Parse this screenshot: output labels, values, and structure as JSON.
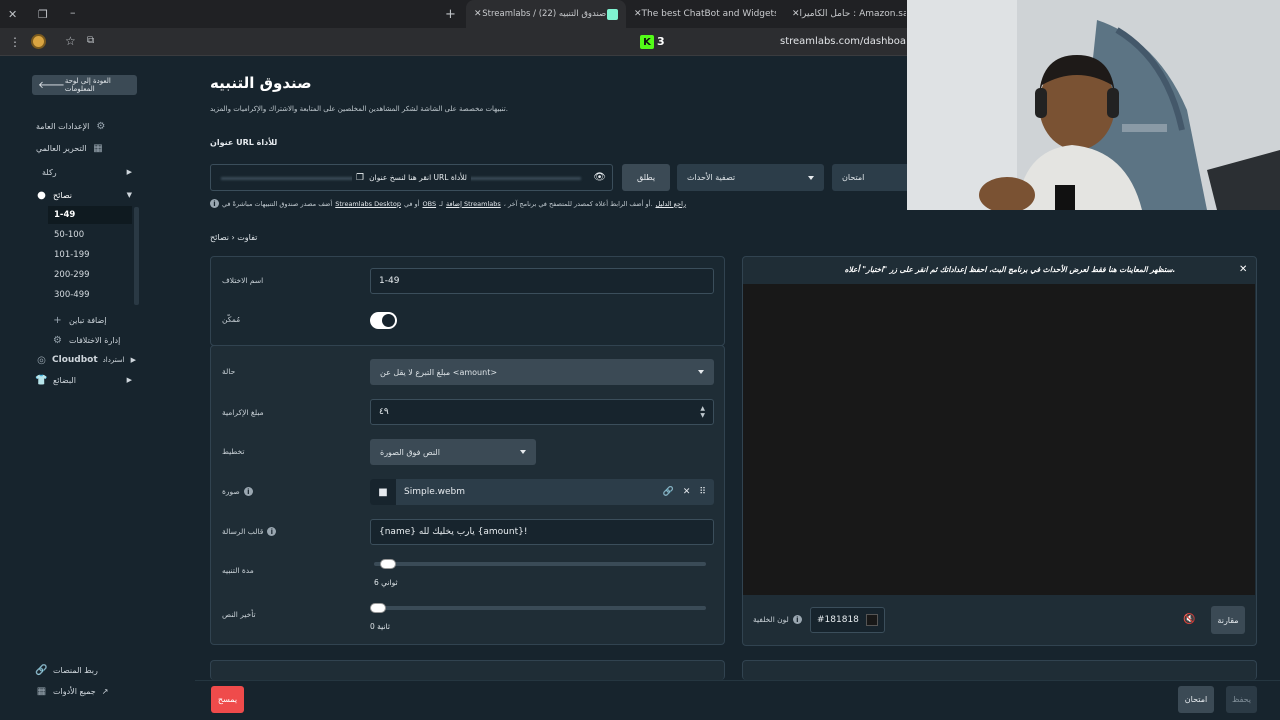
{
  "browser": {
    "tabs": [
      {
        "label": "حامل الكاميرا : Amazon.sa"
      },
      {
        "label": "The best ChatBot and Widgets"
      },
      {
        "label": "Streamlabs / صندوق التنبيه (22)"
      }
    ],
    "url": "streamlabs.com/dashboard#/a",
    "ext_badge": "3"
  },
  "sidebar": {
    "back_label": "العودة إلى لوحة المعلومات",
    "general_settings": "الإعدادات العامة",
    "global_edit": "التحرير العالمي",
    "category": "ركلة",
    "tips": "نصائح",
    "tip_ranges": [
      "1-49",
      "50-100",
      "101-199",
      "200-299",
      "300-499"
    ],
    "add_variation": "إضافة تباين",
    "manage_variations": "إدارة الاختلافات",
    "cloudbot": "Cloudbot",
    "cloudbot_suffix": "استرداد",
    "merch": "البضائع",
    "link_platforms": "ربط المنصات",
    "all_tools": "جميع الأدوات"
  },
  "page": {
    "title": "صندوق التنبيه",
    "subtitle": "تنبيهات مخصصة على الشاشة لشكر المشاهدين المخلصين على المتابعة والاشتراك والإكراميات والمزيد.",
    "widget_url_label": "عنوان URL للأداة",
    "url_overlay": "انقر هنا لنسخ عنوان URL للأداة",
    "launch_button": "يطلق",
    "event_filter": "تصفية الأحداث",
    "test_button": "امتحان",
    "info_text_1": "راجع الدليل",
    "info_text_2": "، أو أضف الرابط أعلاه كمصدر للمتصفح في برنامج آخر.",
    "info_link_1": "إضافة Streamlabs",
    "info_text_3": "لـ",
    "info_link_2": "OBS",
    "info_text_4": "أو في",
    "info_link_3": "Streamlabs Desktop",
    "info_text_5": "أضف مصدر صندوق التنبيهات مباشرةً في",
    "breadcrumb": "تفاوت ‹ نصائح"
  },
  "form": {
    "variation_name_label": "اسم الاختلاف",
    "variation_name_value": "1-49",
    "enabled_label": "مُمكّن",
    "condition_label": "حالة",
    "condition_value": "مبلغ التبرع لا يقل عن <amount>",
    "tip_amount_label": "مبلغ الإكرامية",
    "tip_amount_value": "٤٩",
    "layout_label": "تخطيط",
    "layout_value": "النص فوق الصورة",
    "image_label": "صورة",
    "image_file": "Simple.webm",
    "message_template_label": "قالب الرسالة",
    "message_template_value": "{name} يارب يخليك لله {amount}!",
    "alert_duration_label": "مدة التنبيه",
    "alert_duration_value": "6 ثواني",
    "alert_duration_fraction": 0.02,
    "text_delay_label": "تأخير النص",
    "text_delay_value": "0 ثانية",
    "text_delay_fraction": 0.0
  },
  "preview": {
    "notice": "ستظهر المعاينات هنا فقط لعرض الأحداث في برنامج البث، احفظ إعداداتك ثم انقر على زر \"اختبار\" أعلاه.",
    "bg_color_label": "لون الخلفية",
    "bg_color_value": "#181818",
    "compare_button": "مقارنة"
  },
  "footer": {
    "delete_button": "يمسح",
    "test_button": "امتحان",
    "save_button": "يحفظ"
  },
  "colors": {
    "accent_green": "#80f5d2",
    "delete_red": "#ef4b4b",
    "kick_green": "#53fc18"
  }
}
